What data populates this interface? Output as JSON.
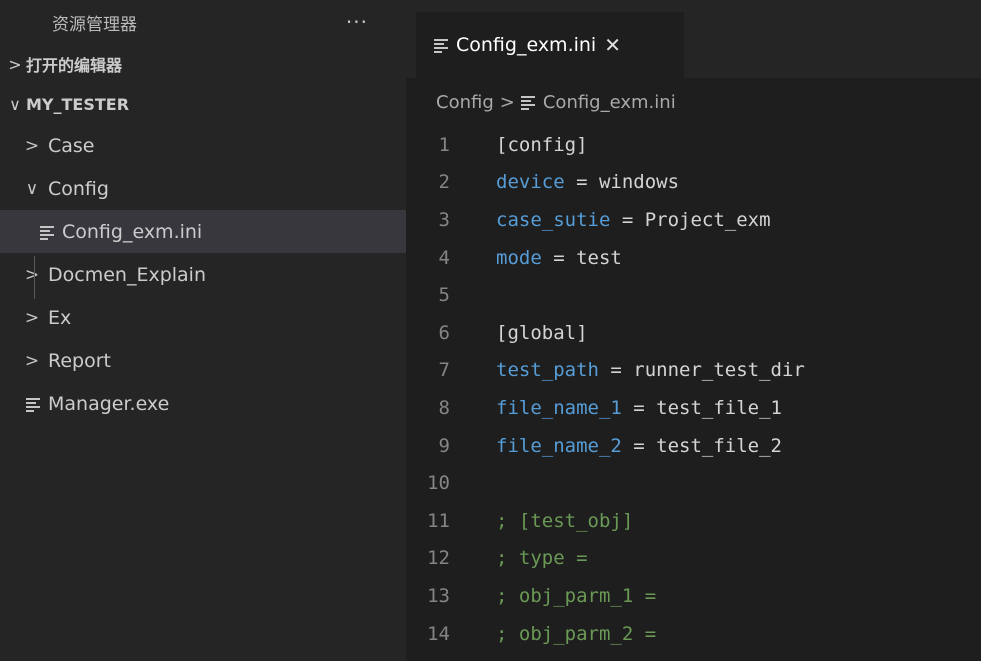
{
  "sidebar": {
    "title": "资源管理器",
    "more_label": "···",
    "open_editors": {
      "chevron": ">",
      "label": "打开的编辑器"
    },
    "project": {
      "chevron": "∨",
      "label": "MY_TESTER"
    },
    "items": [
      {
        "chevron": ">",
        "label": "Case"
      },
      {
        "chevron": "∨",
        "label": "Config"
      },
      {
        "label": "Config_exm.ini"
      },
      {
        "chevron": ">",
        "label": "Docmen_Explain"
      },
      {
        "chevron": ">",
        "label": "Ex"
      },
      {
        "chevron": ">",
        "label": "Report"
      },
      {
        "label": "Manager.exe"
      }
    ]
  },
  "editor": {
    "tab": {
      "label": "Config_exm.ini",
      "close": "✕"
    },
    "breadcrumb": {
      "folder": "Config",
      "sep": ">",
      "file": "Config_exm.ini"
    },
    "lines": [
      {
        "n": "1",
        "parts": [
          {
            "t": "[config]",
            "c": "plain"
          }
        ]
      },
      {
        "n": "2",
        "parts": [
          {
            "t": "device",
            "c": "key"
          },
          {
            "t": " = windows",
            "c": "plain"
          }
        ]
      },
      {
        "n": "3",
        "parts": [
          {
            "t": "case_sutie",
            "c": "key"
          },
          {
            "t": " = Project_exm",
            "c": "plain"
          }
        ]
      },
      {
        "n": "4",
        "parts": [
          {
            "t": "mode",
            "c": "key"
          },
          {
            "t": " = test",
            "c": "plain"
          }
        ]
      },
      {
        "n": "5",
        "parts": []
      },
      {
        "n": "6",
        "parts": [
          {
            "t": "[global]",
            "c": "plain"
          }
        ]
      },
      {
        "n": "7",
        "parts": [
          {
            "t": "test_path",
            "c": "key"
          },
          {
            "t": " = runner_test_dir",
            "c": "plain"
          }
        ]
      },
      {
        "n": "8",
        "parts": [
          {
            "t": "file_name_1",
            "c": "key"
          },
          {
            "t": " = test_file_1",
            "c": "plain"
          }
        ]
      },
      {
        "n": "9",
        "parts": [
          {
            "t": "file_name_2",
            "c": "key"
          },
          {
            "t": " = test_file_2",
            "c": "plain"
          }
        ]
      },
      {
        "n": "10",
        "parts": []
      },
      {
        "n": "11",
        "parts": [
          {
            "t": "; [test_obj]",
            "c": "comment"
          }
        ]
      },
      {
        "n": "12",
        "parts": [
          {
            "t": "; type =",
            "c": "comment"
          }
        ]
      },
      {
        "n": "13",
        "parts": [
          {
            "t": "; obj_parm_1 =",
            "c": "comment"
          }
        ]
      },
      {
        "n": "14",
        "parts": [
          {
            "t": "; obj_parm_2 =",
            "c": "comment"
          }
        ]
      }
    ]
  },
  "colors": {
    "keyword": "#569cd6",
    "plain": "#d4d4d4",
    "comment": "#6a9955",
    "line_number": "#858585",
    "selection": "#37373d"
  },
  "icons": {
    "file": "file-lines-icon",
    "chevron_right": "chevron-right-icon",
    "chevron_down": "chevron-down-icon",
    "more": "more-icon",
    "close": "close-icon"
  }
}
